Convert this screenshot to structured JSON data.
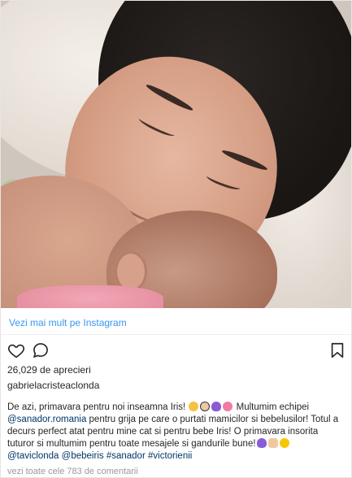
{
  "post": {
    "more_link": "Vezi mai mult pe Instagram",
    "likes": "26,029 de aprecieri",
    "username": "gabrielacristeaclonda",
    "caption": {
      "p1": "De azi, primavara pentru noi inseamna Iris! ",
      "p2": " Multumim echipei ",
      "tag1": "@sanador.romania",
      "p3": " pentru grija pe care o purtati mamicilor si bebelusilor! Totul a decurs perfect atat pentru mine cat si pentru bebe Iris! O primavara insorita tuturor si multumim pentru toate mesajele si gandurile bune!",
      "tag2": "@taviclonda",
      "tag3": "@bebeiris",
      "tag4": "#sanador",
      "tag5": "#victorienii"
    },
    "comments_link": "vezi toate cele 783 de comentarii"
  },
  "icons": {
    "like": "heart-icon",
    "comment": "comment-icon",
    "save": "bookmark-icon"
  },
  "colors": {
    "link": "#3897f0",
    "tag": "#003569",
    "muted": "#999999",
    "text": "#262626"
  }
}
